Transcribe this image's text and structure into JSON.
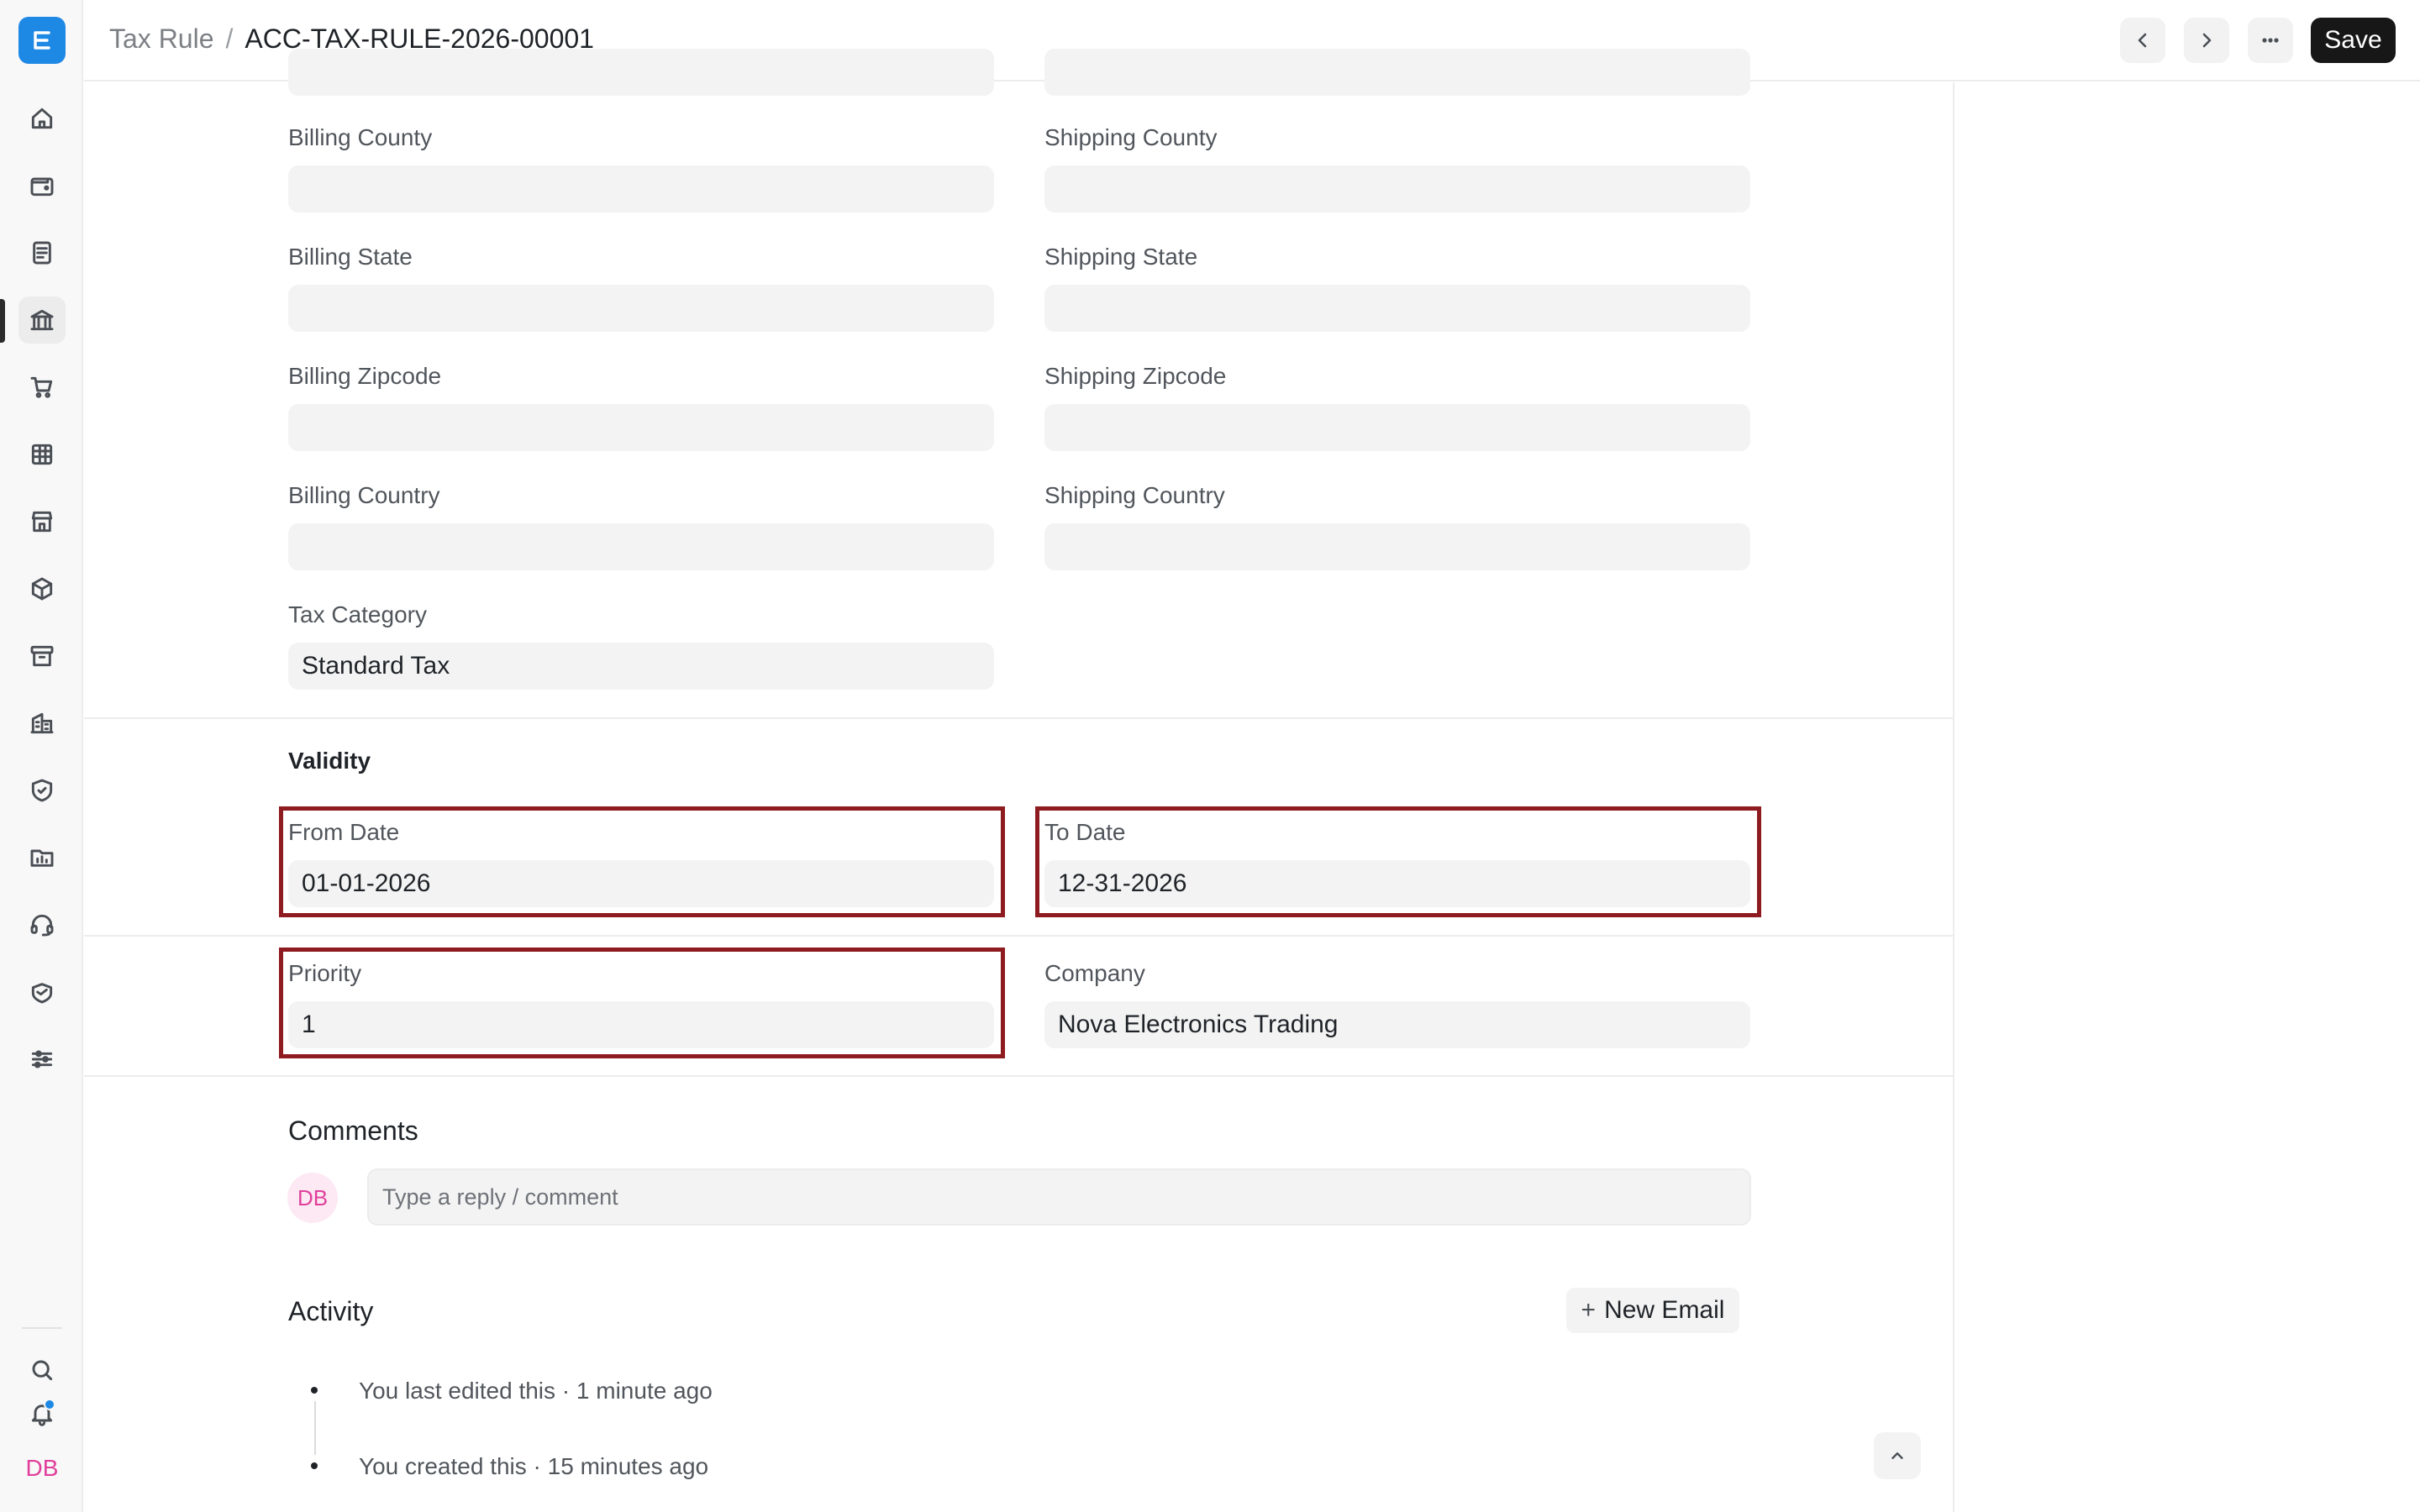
{
  "sidebar": {
    "logo_letter": "E",
    "items": [
      {
        "icon": "home-icon"
      },
      {
        "icon": "wallet-icon"
      },
      {
        "icon": "document-icon"
      },
      {
        "icon": "bank-icon",
        "active": true
      },
      {
        "icon": "cart-icon"
      },
      {
        "icon": "table-icon"
      },
      {
        "icon": "store-icon"
      },
      {
        "icon": "cube-icon"
      },
      {
        "icon": "archive-icon"
      },
      {
        "icon": "building-icon"
      },
      {
        "icon": "shield-icon"
      },
      {
        "icon": "folder-chart-icon"
      },
      {
        "icon": "headset-icon"
      },
      {
        "icon": "handshake-icon"
      },
      {
        "icon": "sliders-icon"
      }
    ],
    "search_icon": "search-icon",
    "bell_icon": "bell-icon",
    "avatar_initials": "DB"
  },
  "header": {
    "breadcrumb_parent": "Tax Rule",
    "breadcrumb_sep": "/",
    "breadcrumb_current": "ACC-TAX-RULE-2026-00001",
    "save_label": "Save"
  },
  "form": {
    "billing_county_label": "Billing County",
    "billing_county_value": "",
    "shipping_county_label": "Shipping County",
    "shipping_county_value": "",
    "billing_state_label": "Billing State",
    "billing_state_value": "",
    "shipping_state_label": "Shipping State",
    "shipping_state_value": "",
    "billing_zipcode_label": "Billing Zipcode",
    "billing_zipcode_value": "",
    "shipping_zipcode_label": "Shipping Zipcode",
    "shipping_zipcode_value": "",
    "billing_country_label": "Billing Country",
    "billing_country_value": "",
    "shipping_country_label": "Shipping Country",
    "shipping_country_value": "",
    "tax_category_label": "Tax Category",
    "tax_category_value": "Standard Tax",
    "validity_title": "Validity",
    "from_date_label": "From Date",
    "from_date_value": "01-01-2026",
    "to_date_label": "To Date",
    "to_date_value": "12-31-2026",
    "priority_label": "Priority",
    "priority_value": "1",
    "company_label": "Company",
    "company_value": "Nova Electronics Trading"
  },
  "comments": {
    "title": "Comments",
    "avatar": "DB",
    "placeholder": "Type a reply / comment"
  },
  "activity": {
    "title": "Activity",
    "new_email_label": "New Email",
    "items": [
      "You last edited this · 1 minute ago",
      "You created this · 15 minutes ago"
    ]
  },
  "colors": {
    "accent": "#1e88e5",
    "highlight_border": "#8e1b1f",
    "avatar_pink": "#e0409b"
  }
}
